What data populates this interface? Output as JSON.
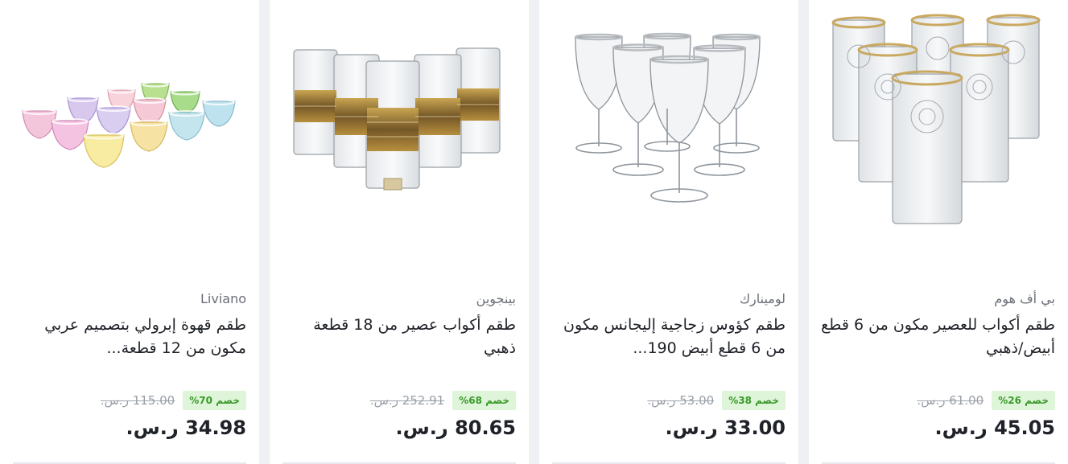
{
  "products": [
    {
      "brand": "بي أف هوم",
      "title": "طقم أكواب للعصير مكون من 6 قطع أبيض/ذهبي",
      "old_price": "61.00 ر.س.",
      "discount": "خصم 26%",
      "price": "45.05 ر.س.",
      "image_icon": "tall-decorated-glasses-icon"
    },
    {
      "brand": "لومينارك",
      "title": "طقم كؤوس زجاجية إليجانس مكون من 6 قطع أبيض 190...",
      "old_price": "53.00 ر.س.",
      "discount": "خصم 38%",
      "price": "33.00 ر.س.",
      "image_icon": "wine-glasses-icon"
    },
    {
      "brand": "بينجوين",
      "title": "طقم أكواب عصير من 18 قطعة ذهبي",
      "old_price": "252.91 ر.س.",
      "discount": "خصم 68%",
      "price": "80.65 ر.س.",
      "image_icon": "gold-band-tumblers-icon"
    },
    {
      "brand": "Liviano",
      "title": "طقم قهوة إبرولي بتصميم عربي مكون من 12 قطعة...",
      "old_price": "115.00 ر.س.",
      "discount": "خصم 70%",
      "price": "34.98 ر.س.",
      "image_icon": "colored-coffee-cups-icon"
    }
  ],
  "colors": {
    "badge_bg": "#dff5d9",
    "badge_text": "#3a9a2a",
    "price_text": "#1f2228",
    "old_price_text": "#9aa0a8"
  }
}
